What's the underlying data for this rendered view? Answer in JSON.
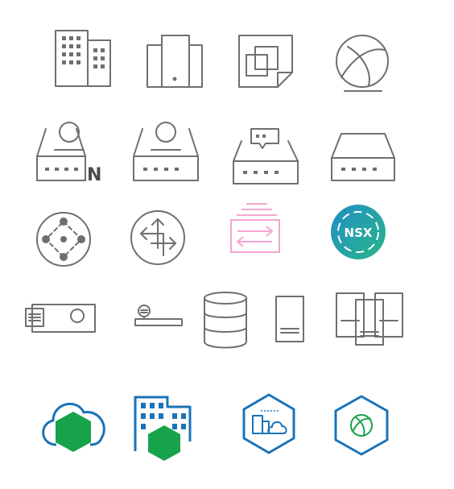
{
  "icons": {
    "row1": [
      "buildings-icon",
      "office-tower-icon",
      "stacked-windows-document-icon",
      "globe-icon"
    ],
    "row2": [
      "network-device-n-icon",
      "network-device-icon",
      "network-device-chat-icon",
      "network-switch-icon"
    ],
    "row3": [
      "network-hub-icon",
      "router-icon",
      "firewall-exchange-icon",
      "nsx-logo-icon"
    ],
    "row4": [
      "projector-icon",
      "load-balancer-icon",
      "database-icon",
      "server-icon",
      "server-cluster-icon"
    ],
    "row5": [
      "cloud-hexagon-icon",
      "building-hexagon-icon",
      "datacenter-cloud-hexagon-icon",
      "globe-hexagon-icon"
    ]
  },
  "labels": {
    "n_letter": "N",
    "nsx": "NSX"
  },
  "colors": {
    "gray": "#6f6f6f",
    "pink": "#f2a7cf",
    "blue": "#1a73b8",
    "green": "#17a34a",
    "nsx_gradient_start": "#1f8fc4",
    "nsx_gradient_end": "#2bb58a"
  }
}
